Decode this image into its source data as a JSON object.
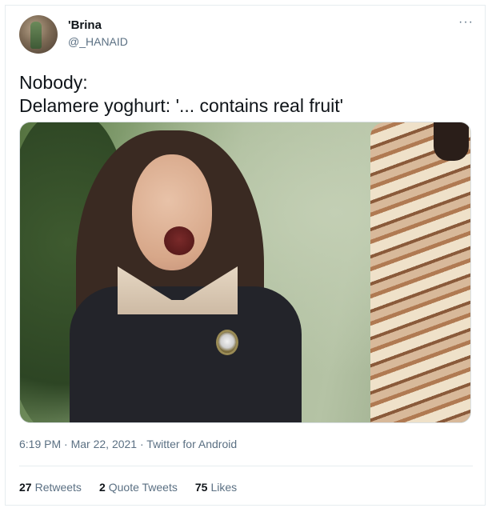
{
  "author": {
    "display_name": "'Brina",
    "handle": "@_HANAID",
    "avatar_icon": "user-avatar"
  },
  "tweet": {
    "text": "Nobody:\nDelamere yoghurt: '... contains real fruit'",
    "media_icon": "photo-media"
  },
  "meta": {
    "time": "6:19 PM",
    "dot1": "·",
    "date": "Mar 22, 2021",
    "dot2": "·",
    "source": "Twitter for Android"
  },
  "stats": {
    "retweets_count": "27",
    "retweets_label": "Retweets",
    "quotes_count": "2",
    "quotes_label": "Quote Tweets",
    "likes_count": "75",
    "likes_label": "Likes"
  },
  "menu": {
    "more_glyph": "···"
  },
  "colors": {
    "text_primary": "#0f1419",
    "text_secondary": "#5b7083",
    "border": "#e6ecf0"
  }
}
